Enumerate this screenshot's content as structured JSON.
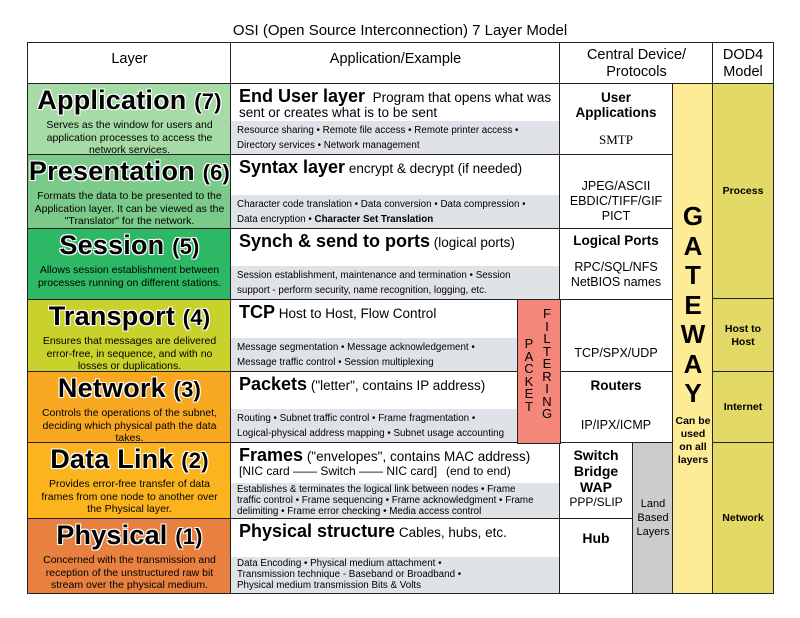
{
  "title": "OSI (Open Source Interconnection) 7 Layer Model",
  "headers": {
    "layer": "Layer",
    "application": "Application/Example",
    "central_line1": "Central Device/",
    "central_line2": "Protocols",
    "dod_line1": "DOD4",
    "dod_line2": "Model"
  },
  "colors": {
    "application": "#a6dba7",
    "presentation": "#7cca8a",
    "session": "#2db865",
    "transport": "#c8d22a",
    "network": "#f7a820",
    "datalink": "#fcb41e",
    "physical": "#e8813f",
    "gateway": "#fdeb96",
    "dod": "#e3d966",
    "packet_filtering": "#f5867a",
    "land_based": "#cccccc",
    "detail_band": "#dfe3e8"
  },
  "layers": [
    {
      "name": "Application",
      "number": "(7)",
      "description": "Serves as the window for users and application processes to access the network services.",
      "example_title": "End User layer",
      "example_text": "Program that opens what was sent or creates what is to be sent",
      "details": [
        "Resource sharing • Remote file access • Remote printer access •",
        "Directory services • Network management"
      ],
      "device_bold": "User Applications",
      "device_text": "SMTP"
    },
    {
      "name": "Presentation",
      "number": "(6)",
      "description": "Formats the data to be presented to the Application layer. It can be viewed as the \"Translator\" for the network.",
      "example_title": "Syntax layer",
      "example_text": "encrypt & decrypt (if needed)",
      "details": [
        "Character code translation • Data conversion • Data compression •",
        "Data encryption • "
      ],
      "details_bold": "Character Set Translation",
      "device_bold": "",
      "device_text": "JPEG/ASCII EBDIC/TIFF/GIF PICT"
    },
    {
      "name": "Session",
      "number": "(5)",
      "description": "Allows session establishment between processes running on different stations.",
      "example_title": "Synch & send to ports",
      "example_text": "(logical ports)",
      "details": [
        "Session establishment, maintenance and termination • Session",
        "support - perform security, name recognition, logging, etc."
      ],
      "device_bold": "Logical Ports",
      "device_text": "RPC/SQL/NFS NetBIOS names"
    },
    {
      "name": "Transport",
      "number": "(4)",
      "description": "Ensures that messages are delivered error-free, in sequence, and with no losses or duplications.",
      "example_title": "TCP",
      "example_text": "Host to Host, Flow Control",
      "details": [
        "Message segmentation • Message acknowledgement •",
        "Message traffic control • Session multiplexing"
      ],
      "device_bold": "",
      "device_text": "TCP/SPX/UDP"
    },
    {
      "name": "Network",
      "number": "(3)",
      "description": "Controls the operations of the subnet, deciding which physical path the data takes.",
      "example_title": "Packets",
      "example_text": "(\"letter\", contains IP address)",
      "details": [
        "Routing • Subnet traffic control • Frame fragmentation •",
        "Logical-physical address mapping • Subnet usage accounting"
      ],
      "device_bold": "Routers",
      "device_text": "IP/IPX/ICMP"
    },
    {
      "name": "Data Link",
      "number": "(2)",
      "description": "Provides error-free transfer of data frames from one node to another over the Physical layer.",
      "example_title": "Frames",
      "example_text": "(\"envelopes\", contains MAC address)",
      "example_line2": "[NIC card —— Switch —— NIC card]",
      "example_line2_right": "(end to end)",
      "details": [
        "Establishes & terminates the logical link between nodes • Frame",
        "traffic control • Frame sequencing • Frame acknowledgment • Frame",
        "delimiting • Frame error checking • Media access control"
      ],
      "device_bold": "Switch Bridge WAP",
      "device_text": "PPP/SLIP"
    },
    {
      "name": "Physical",
      "number": "(1)",
      "description": "Concerned with the transmission and reception of the unstructured raw bit stream over the physical medium.",
      "example_title": "Physical structure",
      "example_text": "Cables, hubs, etc.",
      "details": [
        "Data Encoding • Physical medium attachment •",
        "Transmission technique - Baseband or Broadband •",
        "Physical medium transmission Bits & Volts"
      ],
      "device_bold": "Hub",
      "device_text": ""
    }
  ],
  "gateway": {
    "letters": [
      "G",
      "A",
      "T",
      "E",
      "W",
      "A",
      "Y"
    ],
    "note": "Can be used on all layers"
  },
  "packet_filtering": {
    "packet": [
      "P",
      "A",
      "C",
      "K",
      "E",
      "T"
    ],
    "filtering": [
      "F",
      "I",
      "L",
      "T",
      "E",
      "R",
      "I",
      "N",
      "G"
    ]
  },
  "land_based": "Land Based Layers",
  "dod_model": [
    {
      "label": "Process"
    },
    {
      "label": "Host to Host"
    },
    {
      "label": "Internet"
    },
    {
      "label": "Network"
    }
  ]
}
